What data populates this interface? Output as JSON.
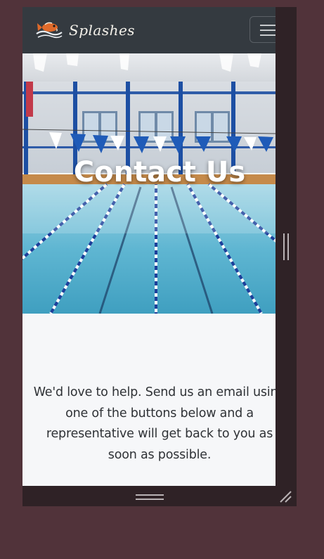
{
  "navbar": {
    "brand_name": "Splashes",
    "logo_icon": "fish-swimmer-logo-icon",
    "menu_icon": "hamburger-menu-icon"
  },
  "hero": {
    "title": "Contact Us",
    "background_image": "indoor-swimming-pool-with-lane-ropes-and-pennant-flags"
  },
  "intro": {
    "text": "We'd love to help. Send us an email using one of the buttons below and a representative will get back to you as soon as possible."
  },
  "chrome": {
    "side_handle_icon": "vertical-resize-handle-icon",
    "bottom_handle_icon": "horizontal-resize-handle-icon",
    "corner_icon": "resize-grip-icon"
  },
  "colors": {
    "page_background": "#51333a",
    "device_frame": "#2f2226",
    "navbar": "#343a40",
    "content_background": "#f6f7f9",
    "body_text": "#2f3236",
    "hero_title": "#ffffff"
  }
}
